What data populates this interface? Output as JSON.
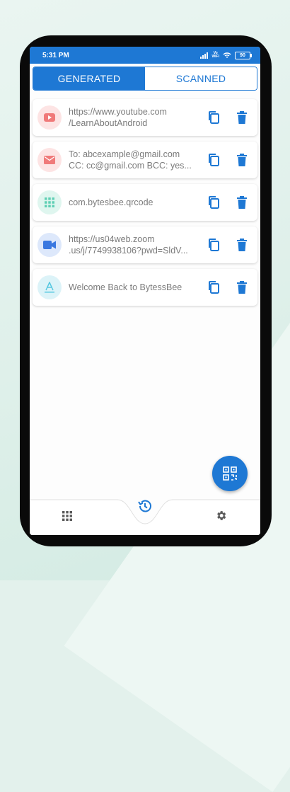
{
  "status_bar": {
    "time": "5:31 PM",
    "network_label": "Vo\nWiFi",
    "battery_level": "90"
  },
  "tabs": [
    {
      "label": "GENERATED",
      "active": true
    },
    {
      "label": "SCANNED",
      "active": false
    }
  ],
  "history_items": [
    {
      "type_icon": "youtube-icon",
      "line1": "https://www.youtube.com",
      "line2": "/LearnAboutAndroid",
      "icon_color": "#f07a7a",
      "icon_bg": "#fde4e4"
    },
    {
      "type_icon": "email-icon",
      "line1": "To: abcexample@gmail.com",
      "line2": "CC: cc@gmail.com BCC: yes...",
      "icon_color": "#f07a7a",
      "icon_bg": "#fde4e4"
    },
    {
      "type_icon": "app-grid-icon",
      "line1": "com.bytesbee.qrcode",
      "line2": "",
      "icon_color": "#5fcfb4",
      "icon_bg": "#dff6ef"
    },
    {
      "type_icon": "video-call-icon",
      "line1": "https://us04web.zoom",
      "line2": ".us/j/7749938106?pwd=SldV...",
      "icon_color": "#3a78e0",
      "icon_bg": "#dde8fb"
    },
    {
      "type_icon": "text-icon",
      "line1": "Welcome Back to BytessBee",
      "line2": "",
      "icon_color": "#55c7e0",
      "icon_bg": "#dcf3f8"
    }
  ],
  "colors": {
    "primary": "#1e78d4",
    "text": "#7b7b7b"
  },
  "bottom_nav": {
    "left_icon": "apps-icon",
    "center_icon": "history-icon",
    "right_icon": "settings-icon"
  }
}
